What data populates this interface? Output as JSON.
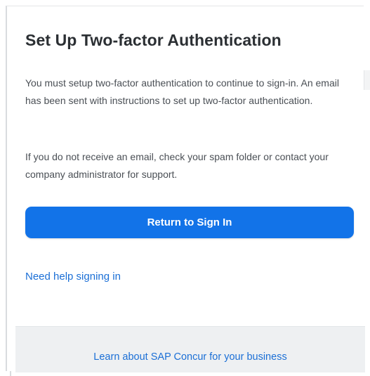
{
  "dialog": {
    "title": "Set Up Two-factor Authentication",
    "message_1": "You must setup two-factor authentication to continue to sign-in. An email has been sent with instructions to set up two-factor authentication.",
    "message_2": "If you do not receive an email, check your spam folder or contact your company administrator for support.",
    "primary_button_label": "Return to Sign In",
    "help_link_label": "Need help signing in"
  },
  "footer": {
    "link_label": "Learn about SAP Concur for your business"
  },
  "colors": {
    "accent": "#1273e8",
    "link": "#1b6fd6",
    "footer_background": "#eef0f2",
    "title_text": "#2b2f33",
    "body_text": "#4a4f55"
  }
}
